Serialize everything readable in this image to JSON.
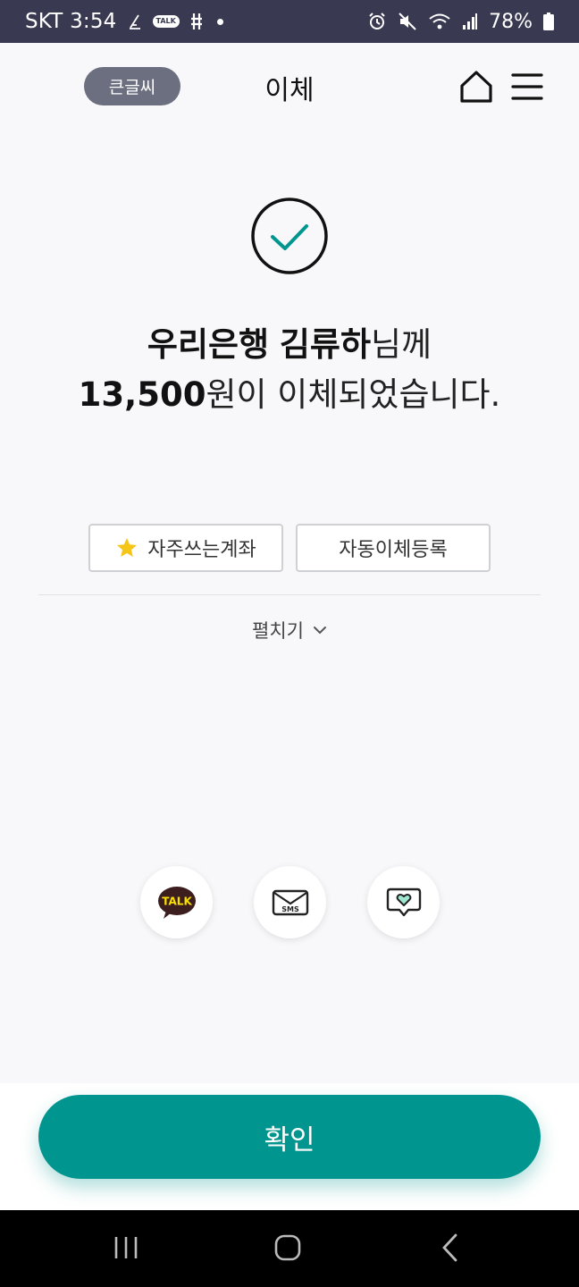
{
  "status_bar": {
    "carrier": "SKT",
    "time": "3:54",
    "talk_badge": "TALK",
    "battery": "78%",
    "icons": [
      "signature-icon",
      "kakaotalk-icon",
      "hash-icon",
      "dot-icon",
      "alarm-icon",
      "mute-icon",
      "wifi-icon",
      "signal-icon",
      "battery-icon"
    ]
  },
  "header": {
    "big_font_label": "큰글씨",
    "title": "이체",
    "icons": [
      "home-icon",
      "menu-icon"
    ]
  },
  "result": {
    "bank": "우리은행",
    "recipient": "김류하",
    "honorific": "님께",
    "amount": "13,500",
    "suffix": "원이 이체되었습니다."
  },
  "actions": {
    "favorite_label": "자주쓰는계좌",
    "auto_transfer_label": "자동이체등록",
    "expand_label": "펼치기"
  },
  "share": {
    "items": [
      "kakaotalk-share",
      "sms-share",
      "heart-message-share"
    ],
    "talk_text": "TALK",
    "sms_text": "SMS"
  },
  "confirm_label": "확인",
  "colors": {
    "accent": "#00968f",
    "status_bar": "#393a52",
    "big_font_pill": "#6c6f80",
    "star": "#f5c518"
  }
}
